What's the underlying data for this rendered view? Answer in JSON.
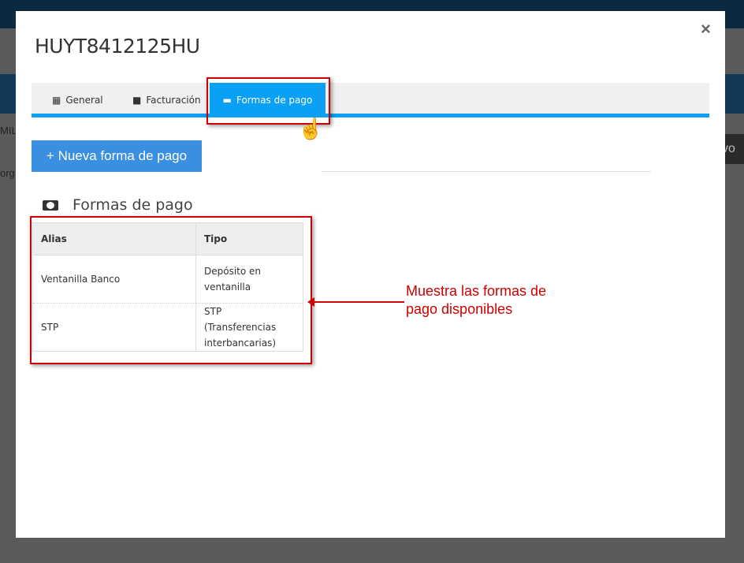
{
  "modal": {
    "title": "HUYT8412125HU",
    "close_label": "×",
    "tabs": [
      {
        "label": "General",
        "icon": "building-icon"
      },
      {
        "label": "Facturación",
        "icon": "briefcase-icon"
      },
      {
        "label": "Formas de pago",
        "icon": "credit-card-icon",
        "active": true
      }
    ],
    "new_button_label": "+ Nueva forma de pago",
    "section_title": "Formas de pago",
    "table": {
      "headers": [
        "Alias",
        "Tipo"
      ],
      "rows": [
        [
          "Ventanilla Banco",
          "Depósito en ventanilla"
        ],
        [
          "STP",
          "STP (Transferencias interbancarias)"
        ]
      ]
    }
  },
  "annotation": {
    "text": "Muestra las formas de pago disponibles",
    "color": "#cc0000"
  },
  "background": {
    "fragments": [
      "MIL",
      "org",
      "vo"
    ]
  },
  "colors": {
    "accent": "#0aa0f5",
    "button": "#3a8fe0"
  }
}
